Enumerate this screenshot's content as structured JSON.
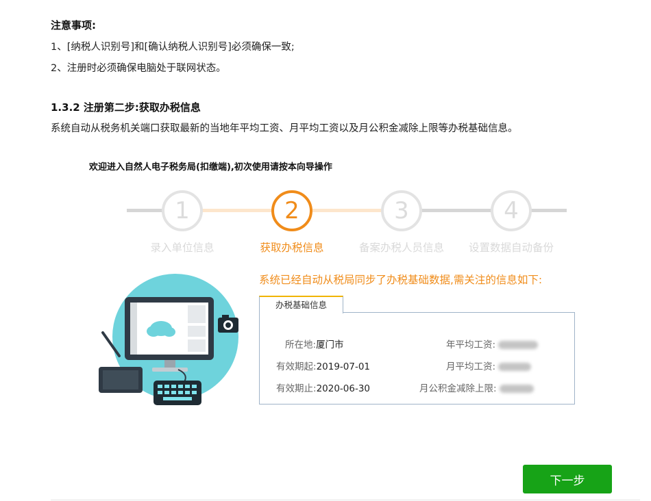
{
  "notes": {
    "title": "注意事项:",
    "line1": "1、[纳税人识别号]和[确认纳税人识别号]必须确保一致;",
    "line2": "2、注册时必须确保电脑处于联网状态。"
  },
  "section": {
    "title": "1.3.2 注册第二步:获取办税信息",
    "desc": "系统自动从税务机关端口获取最新的当地年平均工资、月平均工资以及月公积金减除上限等办税基础信息。"
  },
  "wizard": {
    "welcome": "欢迎进入自然人电子税务局(扣缴端),初次使用请按本向导操作",
    "steps": [
      {
        "number": "1",
        "label": "录入单位信息",
        "active": false
      },
      {
        "number": "2",
        "label": "获取办税信息",
        "active": true
      },
      {
        "number": "3",
        "label": "备案办税人员信息",
        "active": false
      },
      {
        "number": "4",
        "label": "设置数据自动备份",
        "active": false
      }
    ],
    "sync_message": "系统已经自动从税局同步了办税基础数据,需关注的信息如下:",
    "info_tab": "办税基础信息",
    "info": {
      "location_label": "所在地:",
      "location_value": "厦门市",
      "valid_from_label": "有效期起:",
      "valid_from_value": "2019-07-01",
      "valid_to_label": "有效期止:",
      "valid_to_value": "2020-06-30",
      "annual_wage_label": "年平均工资:",
      "monthly_wage_label": "月平均工资:",
      "fund_limit_label": "月公积金减除上限:"
    },
    "next_button": "下一步"
  },
  "colors": {
    "accent_orange": "#f08c1a",
    "button_green": "#17a317",
    "illustration_circle": "#6ed3dc"
  }
}
